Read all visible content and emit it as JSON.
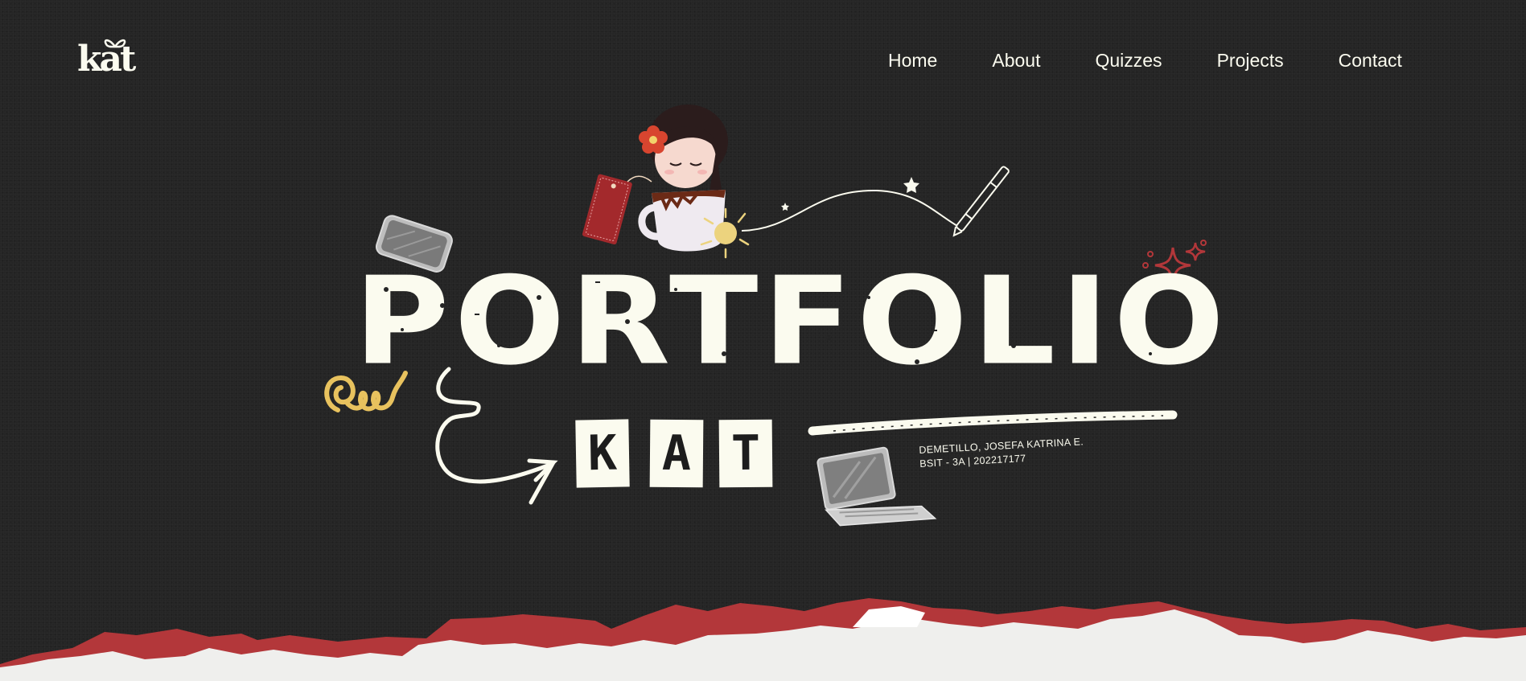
{
  "header": {
    "logo_text": "kat",
    "nav": [
      {
        "label": "Home"
      },
      {
        "label": "About"
      },
      {
        "label": "Quizzes"
      },
      {
        "label": "Projects"
      },
      {
        "label": "Contact"
      }
    ]
  },
  "hero": {
    "title": "PORTFOLIO",
    "subtitle_letters": [
      "K",
      "A",
      "T"
    ],
    "author_name": "DEMETILLO, JOSEFA KATRINA E.",
    "author_details": "BSIT - 3A | 202217177"
  },
  "colors": {
    "background": "#252525",
    "cream": "#fbfbef",
    "accent_red": "#b3373a",
    "accent_yellow": "#e8c25e",
    "paper_white": "#efefed"
  }
}
